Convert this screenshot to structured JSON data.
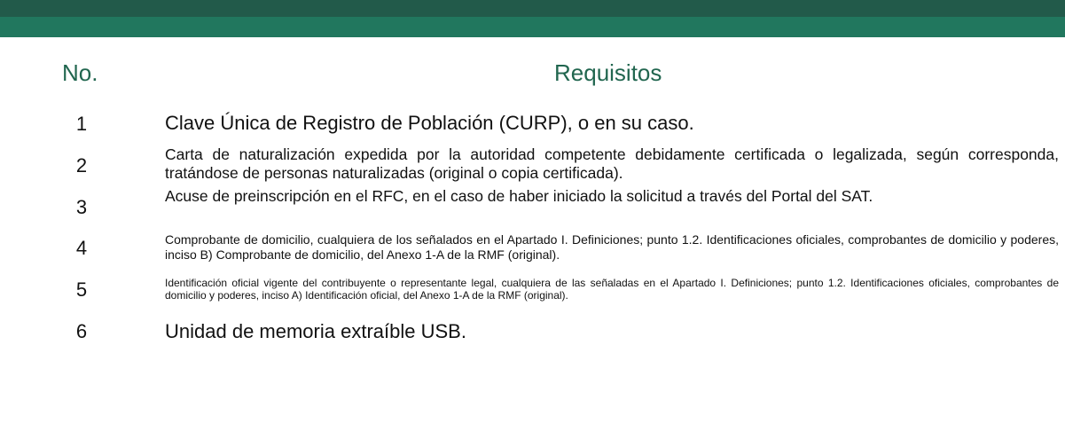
{
  "header": {
    "no": "No.",
    "requisitos": "Requisitos"
  },
  "rows": [
    {
      "num": "1",
      "text": "Clave Única de Registro de Población (CURP), o en su caso."
    },
    {
      "num": "2",
      "text": "Carta de naturalización expedida por la autoridad competente debidamente certificada o legalizada, según corresponda, tratándose de personas naturalizadas (original o copia certificada)."
    },
    {
      "num": "3",
      "text": "Acuse de preinscripción en el RFC, en el caso de haber iniciado la solicitud a través del Portal del SAT."
    },
    {
      "num": "4",
      "text": "Comprobante de domicilio, cualquiera de los señalados en el Apartado I. Definiciones; punto 1.2. Identificaciones oficiales, comprobantes de domicilio y poderes, inciso B) Comprobante de domicilio, del Anexo 1-A de la RMF (original)."
    },
    {
      "num": "5",
      "text": "Identificación oficial vigente del contribuyente o representante legal, cualquiera de las señaladas en el Apartado I. Definiciones; punto 1.2. Identificaciones oficiales, comprobantes de domicilio y poderes, inciso A) Identificación oficial, del Anexo 1-A de la RMF (original)."
    },
    {
      "num": "6",
      "text": "Unidad de memoria extraíble USB."
    }
  ],
  "colors": {
    "header_band_dark": "#225a4a",
    "header_band": "#21775e",
    "heading_text": "#21664f"
  }
}
